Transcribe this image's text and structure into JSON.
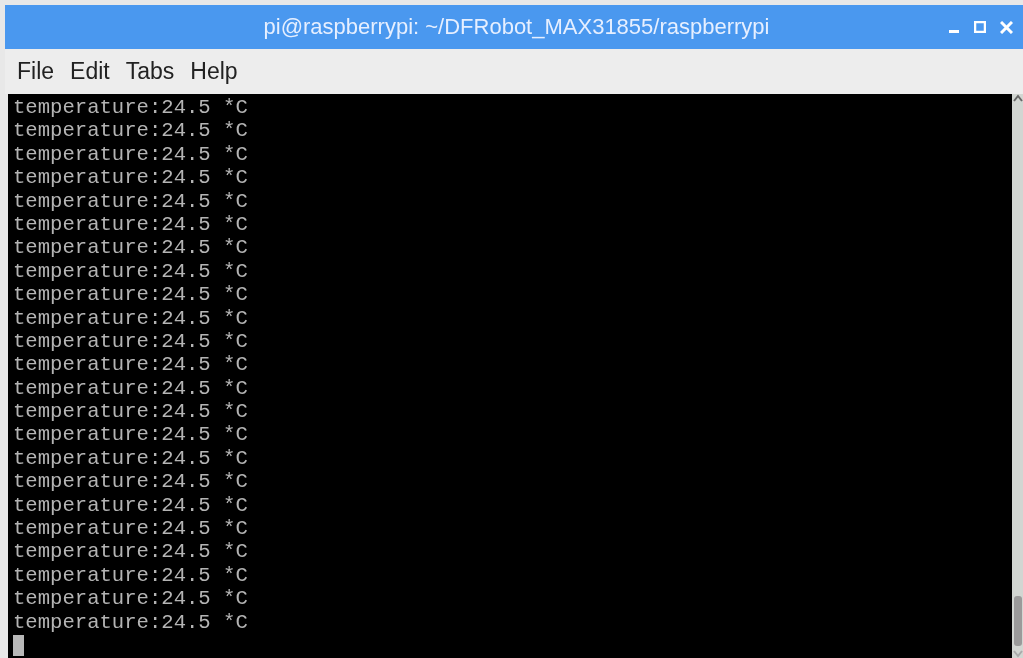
{
  "window": {
    "title": "pi@raspberrypi: ~/DFRobot_MAX31855/raspberrypi"
  },
  "menu": [
    "File",
    "Edit",
    "Tabs",
    "Help"
  ],
  "terminal": {
    "lines": [
      "temperature:24.5 *C",
      "temperature:24.5 *C",
      "temperature:24.5 *C",
      "temperature:24.5 *C",
      "temperature:24.5 *C",
      "temperature:24.5 *C",
      "temperature:24.5 *C",
      "temperature:24.5 *C",
      "temperature:24.5 *C",
      "temperature:24.5 *C",
      "temperature:24.5 *C",
      "temperature:24.5 *C",
      "temperature:24.5 *C",
      "temperature:24.5 *C",
      "temperature:24.5 *C",
      "temperature:24.5 *C",
      "temperature:24.5 *C",
      "temperature:24.5 *C",
      "temperature:24.5 *C",
      "temperature:24.5 *C",
      "temperature:24.5 *C",
      "temperature:24.5 *C",
      "temperature:24.5 *C"
    ]
  }
}
